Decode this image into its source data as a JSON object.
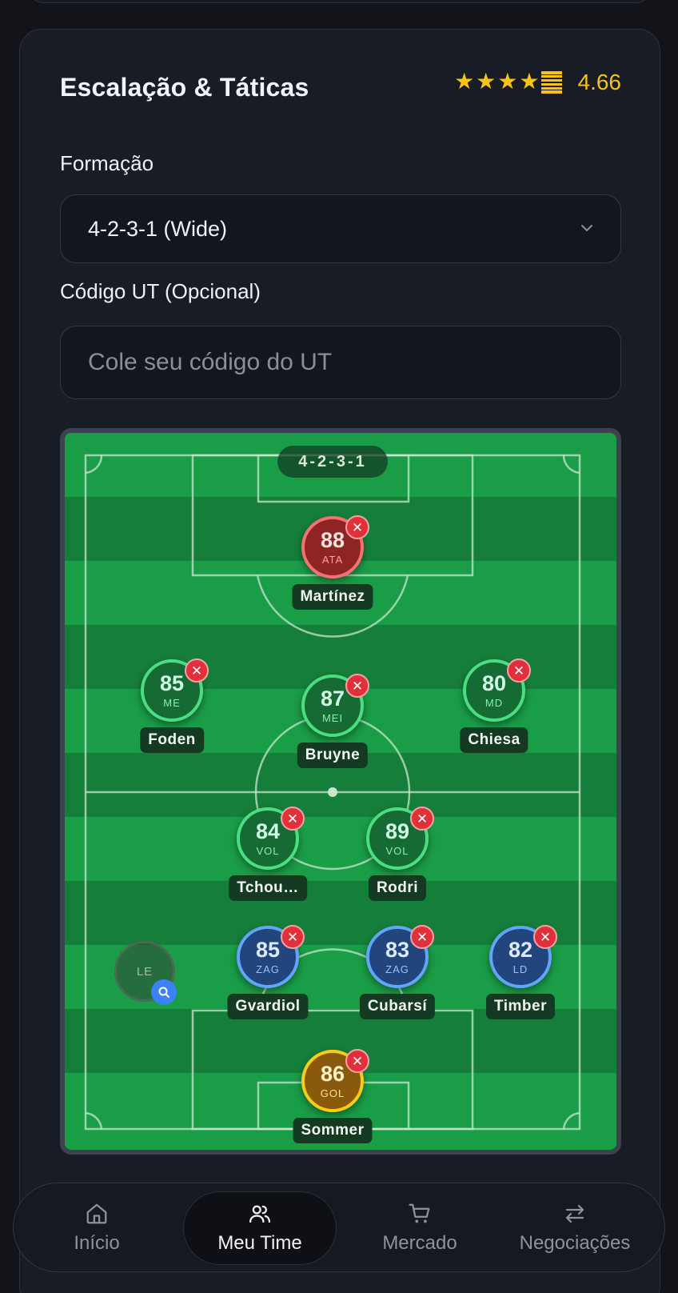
{
  "section": {
    "title": "Escalação & Táticas",
    "rating_value": "4.66",
    "rating_stars": 4.66
  },
  "formation": {
    "label": "Formação",
    "selected": "4-2-3-1 (Wide)"
  },
  "ut_code": {
    "label": "Código UT (Opcional)",
    "placeholder": "Cole seu código do UT",
    "value": ""
  },
  "pitch": {
    "formation_badge": "4-2-3-1",
    "players": [
      {
        "name": "Martínez",
        "rating": "88",
        "position": "ATA"
      },
      {
        "name": "Foden",
        "rating": "85",
        "position": "ME"
      },
      {
        "name": "Bruyne",
        "rating": "87",
        "position": "MEI"
      },
      {
        "name": "Chiesa",
        "rating": "80",
        "position": "MD"
      },
      {
        "name": "Tchou…",
        "rating": "84",
        "position": "VOL"
      },
      {
        "name": "Rodri",
        "rating": "89",
        "position": "VOL"
      },
      {
        "name": "Gvardiol",
        "rating": "85",
        "position": "ZAG"
      },
      {
        "name": "Cubarsí",
        "rating": "83",
        "position": "ZAG"
      },
      {
        "name": "Timber",
        "rating": "82",
        "position": "LD"
      },
      {
        "name": "Sommer",
        "rating": "86",
        "position": "GOL"
      }
    ],
    "empty_slot": {
      "position": "LE"
    }
  },
  "nav": {
    "items": [
      {
        "label": "Início",
        "icon": "home-icon"
      },
      {
        "label": "Meu Time",
        "icon": "users-icon"
      },
      {
        "label": "Mercado",
        "icon": "cart-icon"
      },
      {
        "label": "Negociações",
        "icon": "swap-icon"
      }
    ],
    "active": "Meu Time"
  },
  "colors": {
    "accent": "#f7c21b",
    "attack": "#f87171",
    "midfield": "#4ade80",
    "defense": "#60a5fa",
    "goalkeeper": "#facc15",
    "pitch": "#1a9d47",
    "remove": "#e0313a"
  }
}
